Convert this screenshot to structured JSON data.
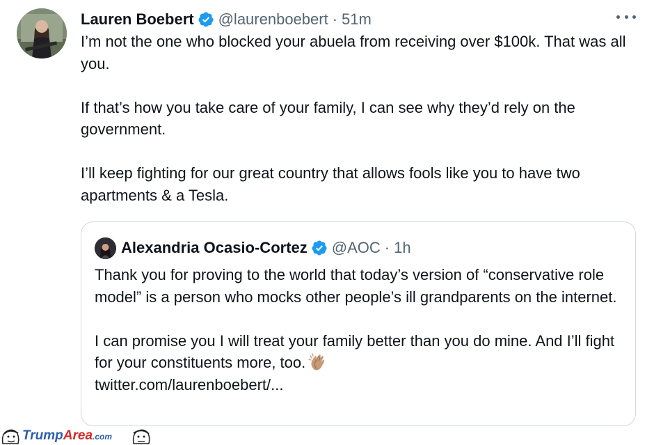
{
  "tweet": {
    "author_name": "Lauren Boebert",
    "handle": "@laurenboebert",
    "separator": "·",
    "time": "51m",
    "paragraphs": [
      "I’m not the one who blocked your abuela from receiving over $100k. That was all you.",
      "If that’s how you take care of your family, I can see why they’d rely on the government.",
      "I’ll keep fighting for our great country that allows fools like you to have two apartments & a Tesla."
    ],
    "more_icon": "more-horizontal-icon",
    "verified_icon": "verified-badge-icon"
  },
  "quote": {
    "author_name": "Alexandria Ocasio-Cortez",
    "handle": "@AOC",
    "separator": "·",
    "time": "1h",
    "paragraph1": "Thank you for proving to the world that today’s version of “conservative role model” is a person who mocks other people’s ill grandparents on the internet.",
    "paragraph2": "I can promise you I will treat your family better than you do mine. And I’ll fight for your constituents more, too.",
    "clap_icon": "clapping-hands-emoji",
    "link": "twitter.com/laurenboebert/..."
  },
  "watermark": {
    "brand_part1": "Trump",
    "brand_part2": "Area",
    "brand_suffix": ".com"
  },
  "colors": {
    "text": "#0f1419",
    "secondary": "#536471",
    "verified": "#1d9bf0",
    "border": "#cfd9de"
  }
}
